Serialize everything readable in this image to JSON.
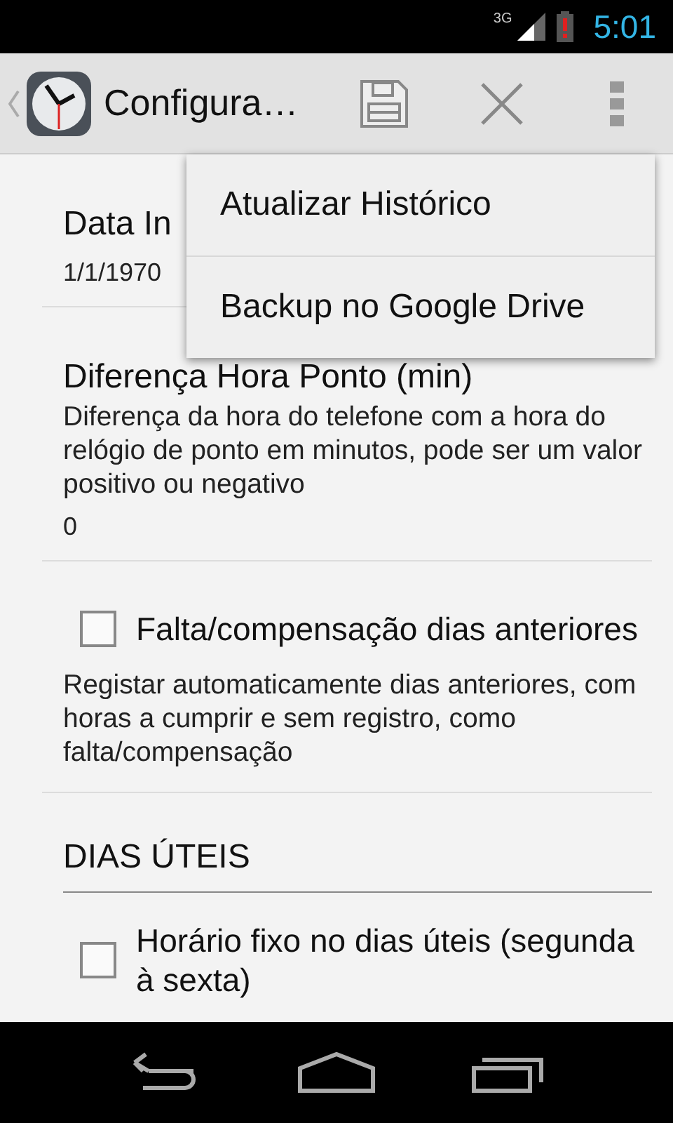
{
  "status_bar": {
    "network": "3G",
    "time": "5:01"
  },
  "action_bar": {
    "title": "Configura…"
  },
  "preferences": [
    {
      "kind": "text",
      "title": "Data In",
      "value": "1/1/1970"
    },
    {
      "kind": "text",
      "title": "Diferença Hora Ponto (min)",
      "summary": "Diferença da hora do telefone com a hora do relógio de ponto em minutos, pode ser um valor positivo ou negativo",
      "value": "0"
    },
    {
      "kind": "checkbox",
      "title": "Falta/compensação dias anteriores",
      "summary": "Registar automaticamente dias anteriores, com horas a cumprir e sem registro, como falta/compensação",
      "checked": false
    },
    {
      "kind": "category",
      "title": "DIAS ÚTEIS"
    },
    {
      "kind": "checkbox",
      "title": "Horário fixo no dias úteis (segunda à sexta)",
      "checked": false
    }
  ],
  "overflow_menu": {
    "items": [
      "Atualizar Histórico",
      "Backup no Google Drive"
    ]
  }
}
